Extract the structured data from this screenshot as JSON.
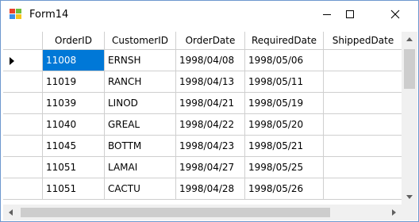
{
  "window": {
    "title": "Form14",
    "icons": {
      "app": "winforms-app-icon",
      "minimize": "minimize-icon",
      "maximize": "maximize-icon",
      "close": "close-icon"
    }
  },
  "grid": {
    "columns": [
      "OrderID",
      "CustomerID",
      "OrderDate",
      "RequiredDate",
      "ShippedDate"
    ],
    "rows": [
      [
        "11008",
        "ERNSH",
        "1998/04/08",
        "1998/05/06",
        ""
      ],
      [
        "11019",
        "RANCH",
        "1998/04/13",
        "1998/05/11",
        ""
      ],
      [
        "11039",
        "LINOD",
        "1998/04/21",
        "1998/05/19",
        ""
      ],
      [
        "11040",
        "GREAL",
        "1998/04/22",
        "1998/05/20",
        ""
      ],
      [
        "11045",
        "BOTTM",
        "1998/04/23",
        "1998/05/21",
        ""
      ],
      [
        "11051",
        "LAMAI",
        "1998/04/27",
        "1998/05/25",
        ""
      ],
      [
        "11051",
        "CACTU",
        "1998/04/28",
        "1998/05/26",
        ""
      ]
    ],
    "selected_row": 0,
    "selected_col": 0,
    "colors": {
      "selection": "#0078d7",
      "gridline": "#cfcfcf",
      "background_area": "#ababab"
    }
  }
}
